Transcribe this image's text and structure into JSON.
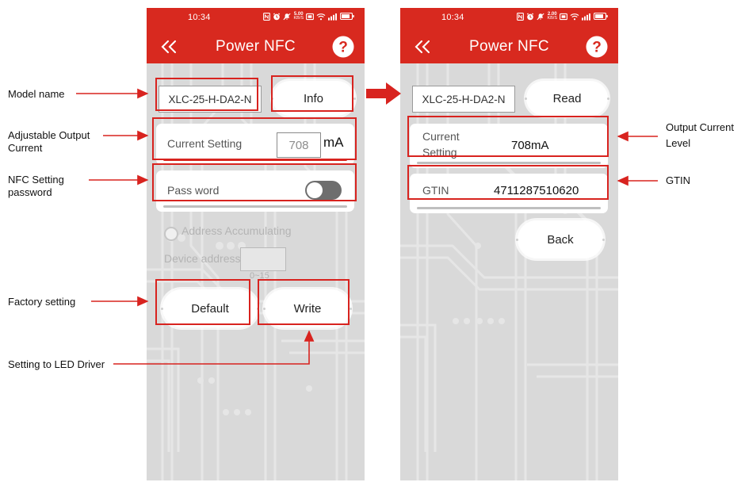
{
  "phones": {
    "left": {
      "status": {
        "time": "10:34",
        "rate_value": "5.00",
        "rate_unit": "KB/S",
        "icons": [
          "nfc-icon",
          "alarm-icon",
          "bell-mute-icon",
          "data-rate-icon",
          "screenshot-icon",
          "wifi-icon",
          "signal-icon",
          "battery-icon"
        ]
      },
      "appbar": {
        "title": "Power NFC",
        "back_icon": "double-chevron-left-icon",
        "help_icon": "question-mark-icon"
      },
      "model_value": "XLC-25-H-DA2-N",
      "info_button": "Info",
      "current_setting": {
        "label": "Current Setting",
        "value": "708",
        "unit": "mA"
      },
      "password": {
        "label": "Pass word",
        "toggle_state": "off"
      },
      "address_accumulating": {
        "label": "Address Accumulating",
        "checked": "false"
      },
      "device_address": {
        "label": "Device address",
        "value": "",
        "hint": "0~15"
      },
      "default_button": "Default",
      "write_button": "Write"
    },
    "right": {
      "status": {
        "time": "10:34",
        "rate_value": "2.00",
        "rate_unit": "KB/S",
        "icons": [
          "nfc-icon",
          "alarm-icon",
          "bell-mute-icon",
          "data-rate-icon",
          "screenshot-icon",
          "wifi-icon",
          "signal-icon",
          "battery-icon"
        ]
      },
      "appbar": {
        "title": "Power NFC",
        "back_icon": "double-chevron-left-icon",
        "help_icon": "question-mark-icon"
      },
      "model_value": "XLC-25-H-DA2-N",
      "read_button": "Read",
      "current_setting": {
        "label_line1": "Current",
        "label_line2": "Setting",
        "value": "708mA"
      },
      "gtin": {
        "label": "GTIN",
        "value": "4711287510620"
      },
      "back_button": "Back"
    }
  },
  "annotations": {
    "model_name": "Model  name",
    "adjustable_output_current_l1": "Adjustable Output",
    "adjustable_output_current_l2": "Current",
    "nfc_setting_password_l1": "NFC Setting",
    "nfc_setting_password_l2": "password",
    "factory_setting": "Factory setting",
    "setting_to_led_driver": "Setting to LED Driver",
    "output_current_level_l1": "Output Current",
    "output_current_level_l2": "Level",
    "gtin": "GTIN"
  },
  "colors": {
    "brand_red": "#d8291f",
    "annotation_red": "#d8231f",
    "phone_bg": "#d9d9d9",
    "card_white": "#ffffff"
  }
}
